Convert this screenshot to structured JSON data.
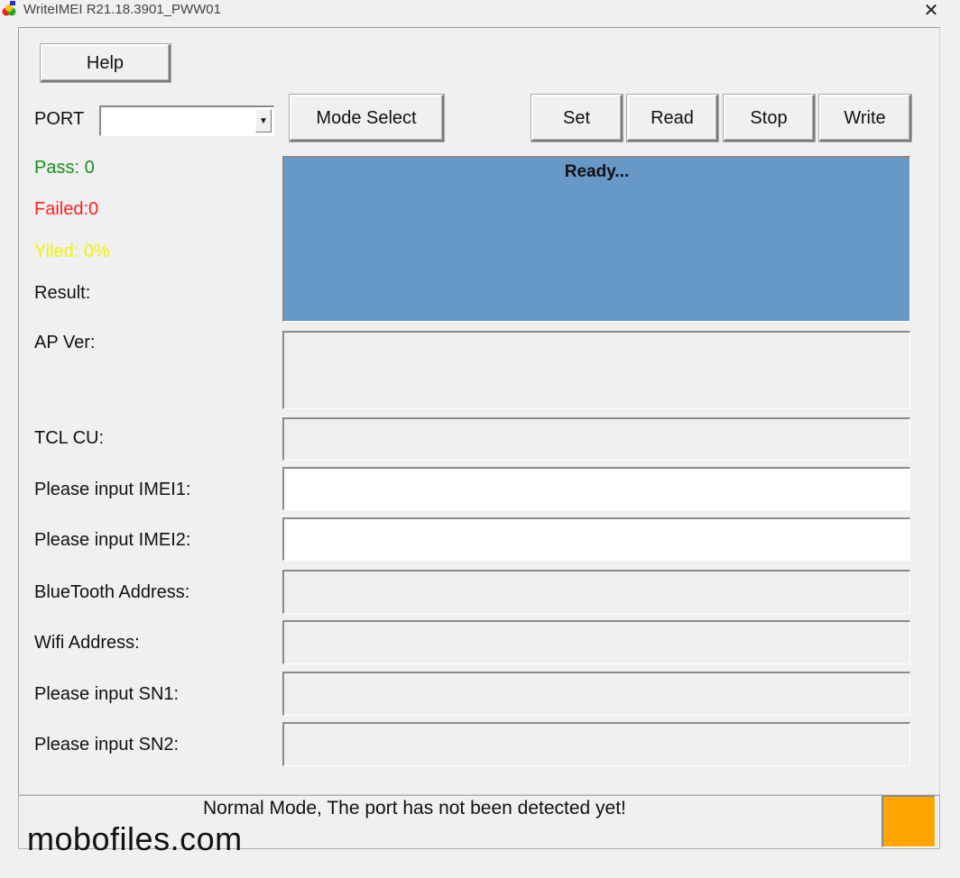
{
  "window": {
    "title": "WriteIMEI R21.18.3901_PWW01",
    "close_glyph": "✕"
  },
  "toolbar": {
    "help_label": "Help",
    "port_label": "PORT",
    "port_value": "",
    "mode_select_label": "Mode Select",
    "set_label": "Set",
    "read_label": "Read",
    "stop_label": "Stop",
    "write_label": "Write"
  },
  "stats": {
    "pass": "Pass:  0",
    "failed": "Failed:0",
    "yield": "Yiled:  0%",
    "result": "Result:",
    "colors": {
      "pass": "#1a8c1a",
      "failed": "#ff2020",
      "yield": "#f2f200"
    }
  },
  "status_panel": {
    "text": "Ready...",
    "color": "#6699c8"
  },
  "fields": {
    "ap_ver": {
      "label": "AP Ver:",
      "value": ""
    },
    "tcl_cu": {
      "label": "TCL CU:",
      "value": ""
    },
    "imei1": {
      "label": "Please input IMEI1:",
      "value": ""
    },
    "imei2": {
      "label": "Please input IMEI2:",
      "value": ""
    },
    "bt_addr": {
      "label": "BlueTooth Address:",
      "value": ""
    },
    "wifi_addr": {
      "label": "Wifi Address:",
      "value": ""
    },
    "sn1": {
      "label": "Please input SN1:",
      "value": ""
    },
    "sn2": {
      "label": "Please input SN2:",
      "value": ""
    }
  },
  "statusbar": {
    "message": "Normal Mode, The port has not been detected yet!",
    "led_color": "#ffa500"
  },
  "watermark": "mobofiles.com"
}
